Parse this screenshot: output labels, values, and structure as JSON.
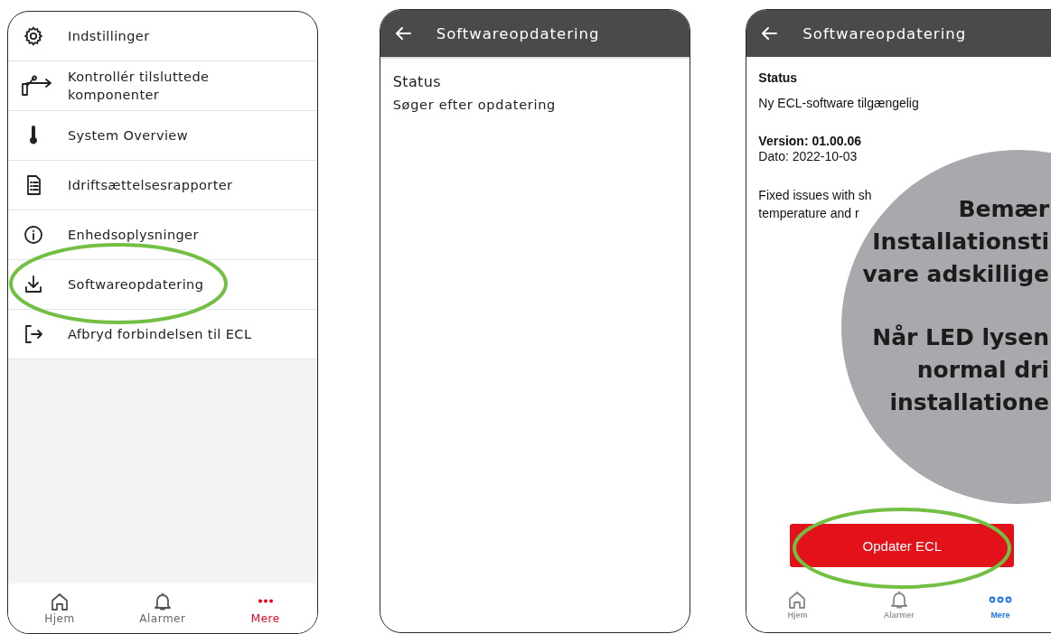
{
  "screens": [
    {
      "kind": "menu",
      "items": [
        "Indstillinger",
        "Kontrollér tilsluttede komponenter",
        "System Overview",
        "Idriftsættelsesrapporter",
        "Enhedsoplysninger",
        "Softwareopdatering",
        "Afbryd forbindelsen til ECL"
      ],
      "nav": [
        {
          "label": "Hjem",
          "selected": false
        },
        {
          "label": "Alarmer",
          "selected": false
        },
        {
          "label": "Mere",
          "selected": true
        }
      ]
    },
    {
      "kind": "search",
      "header": {
        "title": "Softwareopdatering"
      },
      "status_label": "Status",
      "status_text": "Søger efter opdatering"
    },
    {
      "kind": "update",
      "header": {
        "title": "Softwareopdatering"
      },
      "status_label": "Status",
      "status_text": "Ny ECL-software tilgængelig",
      "version": "Version: 01.00.06",
      "date": "Dato: 2022-10-03",
      "notes": [
        "Fixed issues with sh",
        "temperature and r"
      ],
      "button": "Opdater ECL",
      "nav": [
        {
          "label": "Hjem",
          "selected": false
        },
        {
          "label": "Alarmer",
          "selected": false
        },
        {
          "label": "Mere",
          "selected": true
        }
      ]
    }
  ],
  "overlay": {
    "paragraphs": [
      [
        "Bemær",
        "Installationsti",
        "vare adskillige"
      ],
      [
        "Når LED lysen",
        "normal dri",
        "installatione"
      ]
    ]
  }
}
